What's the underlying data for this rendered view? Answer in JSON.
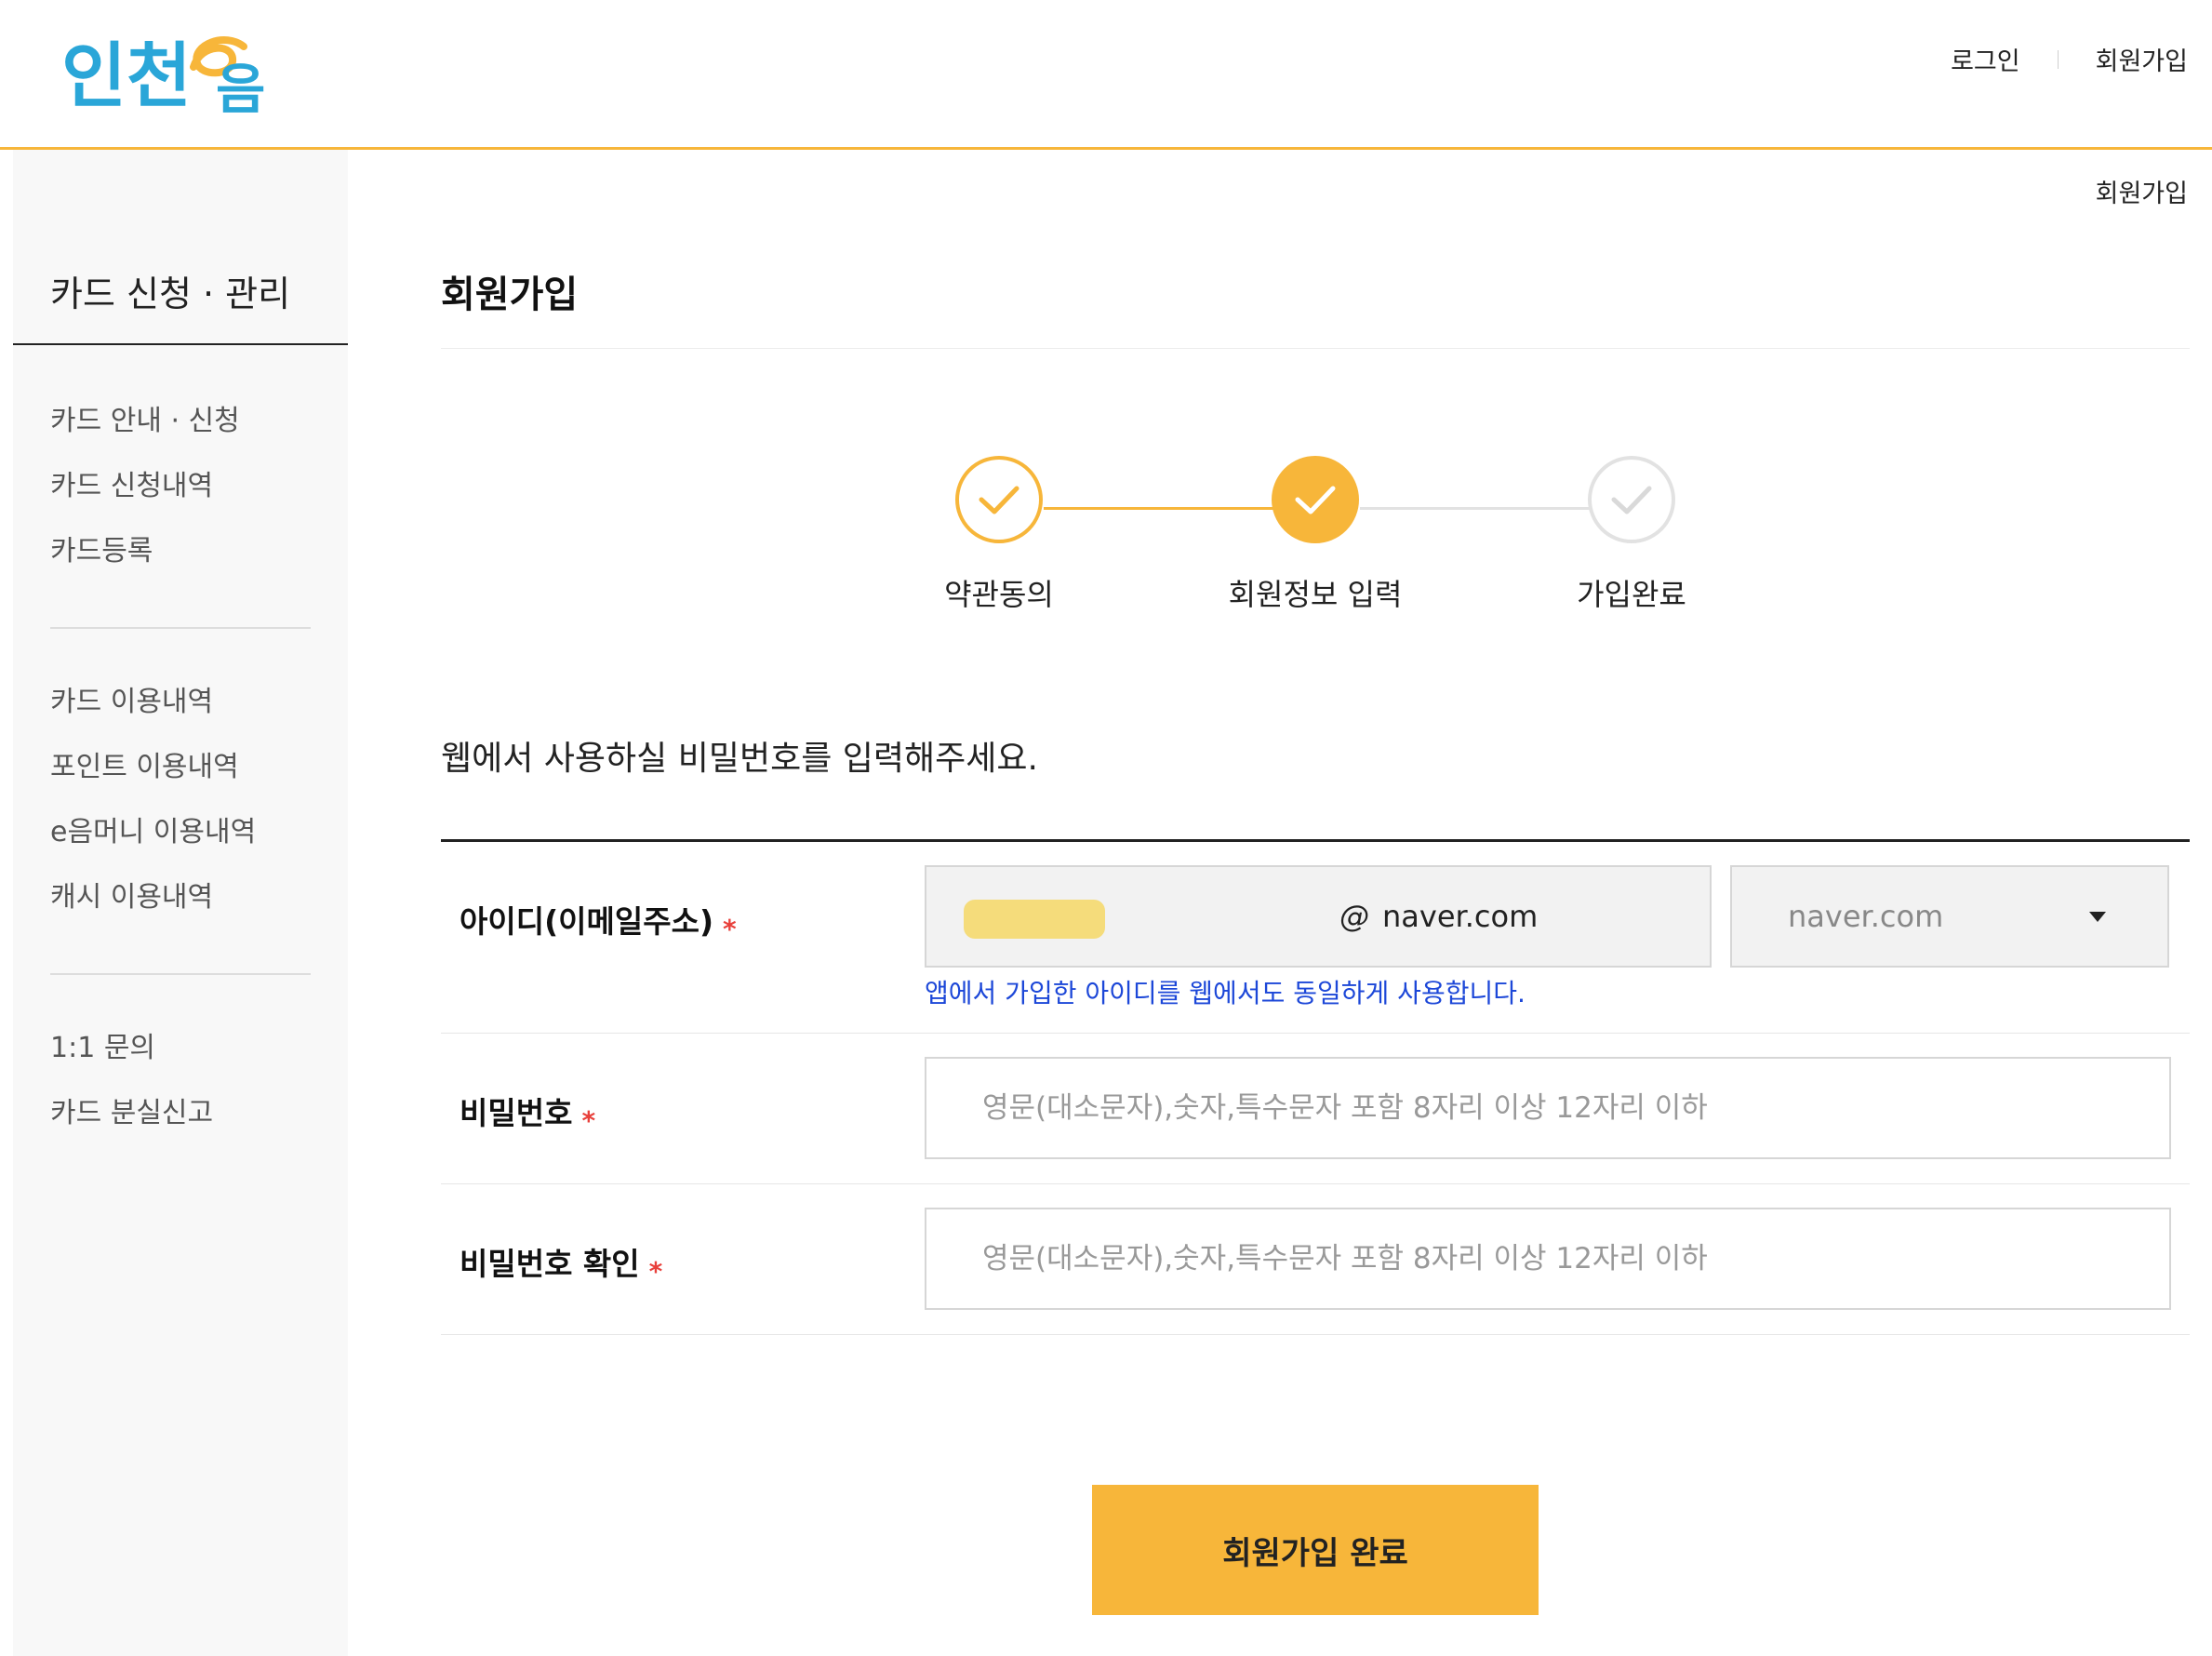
{
  "brand": {
    "logo_text": "인천e음",
    "accent_color": "#f7b63a",
    "logo_blue": "#2aa6d8"
  },
  "top_nav": {
    "login": "로그인",
    "signup": "회원가입"
  },
  "breadcrumb": "회원가입",
  "sidebar": {
    "title": "카드 신청 · 관리",
    "groups": [
      [
        "카드 안내 · 신청",
        "카드 신청내역",
        "카드등록"
      ],
      [
        "카드 이용내역",
        "포인트 이용내역",
        "e음머니 이용내역",
        "캐시 이용내역"
      ],
      [
        "1:1 문의",
        "카드 분실신고"
      ]
    ]
  },
  "main": {
    "title": "회원가입",
    "steps": [
      {
        "label": "약관동의",
        "state": "done"
      },
      {
        "label": "회원정보 입력",
        "state": "current"
      },
      {
        "label": "가입완료",
        "state": "pending"
      }
    ],
    "instruction": "웹에서 사용하실 비밀번호를 입력해주세요.",
    "form": {
      "id_label": "아이디(이메일주소)",
      "required_mark": "*",
      "email_at": "@",
      "email_domain": "naver.com",
      "domain_select_value": "naver.com",
      "id_note": "앱에서 가입한 아이디를 웹에서도 동일하게 사용합니다.",
      "password_label": "비밀번호",
      "password_placeholder": "영문(대소문자),숫자,특수문자 포함 8자리 이상 12자리 이하",
      "password_confirm_label": "비밀번호 확인",
      "password_confirm_placeholder": "영문(대소문자),숫자,특수문자 포함 8자리 이상 12자리 이하"
    },
    "submit_label": "회원가입 완료"
  }
}
